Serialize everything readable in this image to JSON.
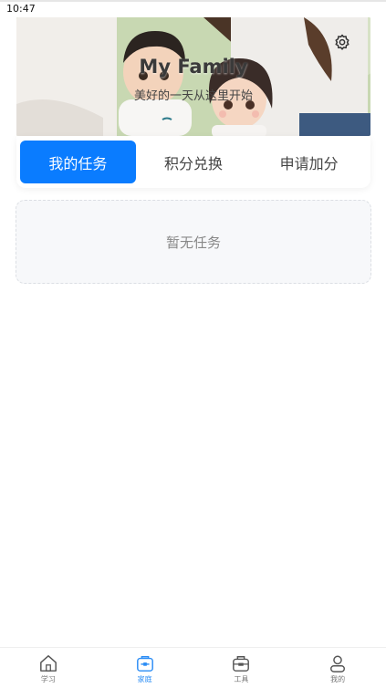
{
  "status_bar": {
    "time": "10:47"
  },
  "banner": {
    "title": "My Family",
    "subtitle": "美好的一天从这里开始"
  },
  "tabs": [
    {
      "label": "我的任务",
      "active": true
    },
    {
      "label": "积分兑换",
      "active": false
    },
    {
      "label": "申请加分",
      "active": false
    }
  ],
  "task_list": {
    "empty_text": "暂无任务"
  },
  "bottom_nav": [
    {
      "label": "学习",
      "icon": "home-icon",
      "active": false
    },
    {
      "label": "家庭",
      "icon": "family-icon",
      "active": true
    },
    {
      "label": "工具",
      "icon": "toolbox-icon",
      "active": false
    },
    {
      "label": "我的",
      "icon": "user-icon",
      "active": false
    }
  ],
  "colors": {
    "accent": "#0a7cff",
    "nav_active": "#2a8cf5"
  }
}
